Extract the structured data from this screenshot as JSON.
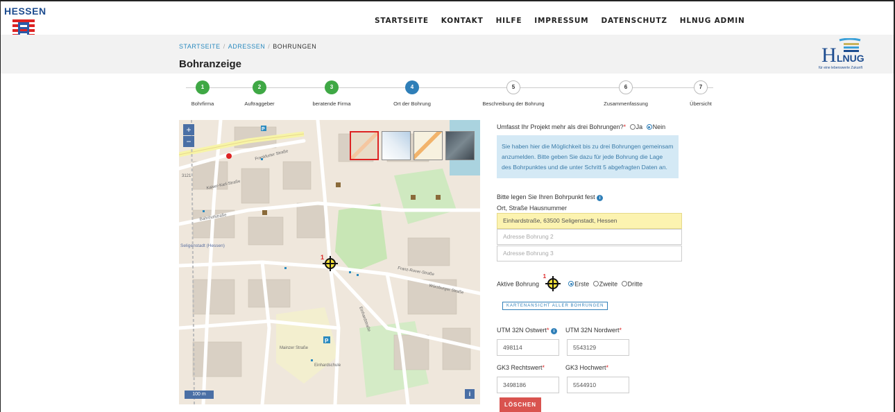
{
  "brand": {
    "hessen_text": "HESSEN",
    "hlnug_text": "HLNUG",
    "hlnug_tagline": "für eine lebenswerte Zukunft"
  },
  "nav": [
    "STARTSEITE",
    "KONTAKT",
    "HILFE",
    "IMPRESSUM",
    "DATENSCHUTZ",
    "HLNUG ADMIN"
  ],
  "breadcrumb": [
    "STARTSEITE",
    "ADRESSEN",
    "BOHRUNGEN"
  ],
  "page_title": "Bohranzeige",
  "steps": [
    {
      "num": "1",
      "label": "Bohrfirma",
      "state": "done"
    },
    {
      "num": "2",
      "label": "Auftraggeber",
      "state": "done"
    },
    {
      "num": "3",
      "label": "beratende Firma",
      "state": "done"
    },
    {
      "num": "4",
      "label": "Ort der Bohrung",
      "state": "active"
    },
    {
      "num": "5",
      "label": "Beschreibung der Bohrung",
      "state": "todo"
    },
    {
      "num": "6",
      "label": "Zusammenfassung",
      "state": "todo"
    },
    {
      "num": "7",
      "label": "Übersicht",
      "state": "todo"
    }
  ],
  "map": {
    "zoom_in": "+",
    "zoom_out": "−",
    "scale": "100 m",
    "info": "i",
    "marker_label": "1",
    "street_labels": [
      "Frankfurter Straße",
      "Kaiser-Karl-Straße",
      "Bahnhofstraße",
      "Würzburger Straße",
      "Franz-Rover-Straße",
      "Einhardstraße",
      "Seligenstadt (Hessen)",
      "Einhardschule",
      "Mainzer Straße",
      "3121"
    ]
  },
  "form": {
    "question": "Umfasst Ihr Projekt mehr als drei Bohrungen?",
    "opt_ja": "Ja",
    "opt_nein": "Nein",
    "info_text": "Sie haben hier die Möglichkeit bis zu drei Bohrungen gemeinsam anzumelden. Bitte geben Sie dazu für jede Bohrung die Lage des Bohrpunktes und die unter Schritt 5 abgefragten Daten an.",
    "point_label": "Bitte legen Sie Ihren Bohrpunkt fest",
    "address_label": "Ort, Straße Hausnummer",
    "address1_value": "Einhardstraße, 63500 Seligenstadt, Hessen",
    "address2_placeholder": "Adresse Bohrung 2",
    "address3_placeholder": "Adresse Bohrung 3",
    "aktive_label": "Aktive Bohrung",
    "opt_erste": "Erste",
    "opt_zweite": "Zweite",
    "opt_dritte": "Dritte",
    "karten_button": "KARTENANSICHT ALLER BOHRUNGEN",
    "utm_ost_label": "UTM 32N Ostwert",
    "utm_nord_label": "UTM 32N Nordwert",
    "utm_ost_value": "498114",
    "utm_nord_value": "5543129",
    "gk3_rechts_label": "GK3 Rechtswert",
    "gk3_hoch_label": "GK3 Hochwert",
    "gk3_rechts_value": "3498186",
    "gk3_hoch_value": "5544910",
    "delete_button": "LÖSCHEN",
    "marker_num": "1"
  }
}
